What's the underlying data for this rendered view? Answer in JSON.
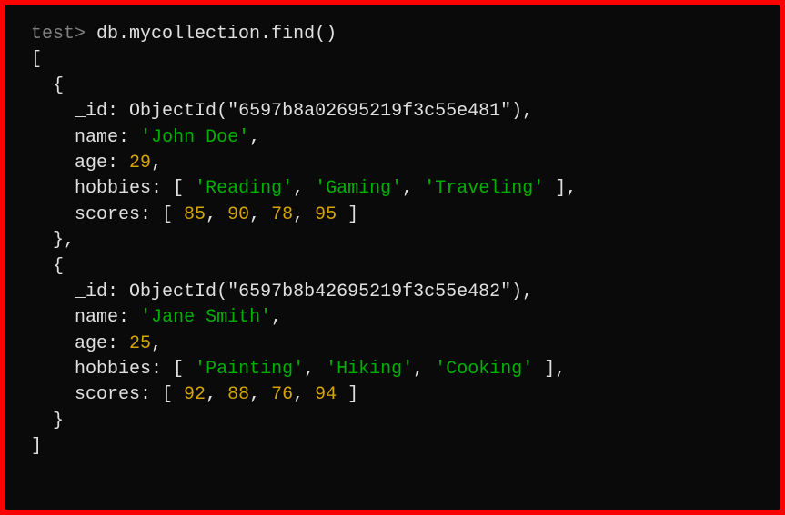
{
  "prompt": {
    "db": "test",
    "command": "db.mycollection.find()"
  },
  "results": [
    {
      "id_func": "ObjectId",
      "id": "6597b8a02695219f3c55e481",
      "name": "John Doe",
      "age": 29,
      "hobbies": [
        "Reading",
        "Gaming",
        "Traveling"
      ],
      "scores": [
        85,
        90,
        78,
        95
      ]
    },
    {
      "id_func": "ObjectId",
      "id": "6597b8b42695219f3c55e482",
      "name": "Jane Smith",
      "age": 25,
      "hobbies": [
        "Painting",
        "Hiking",
        "Cooking"
      ],
      "scores": [
        92,
        88,
        76,
        94
      ]
    }
  ],
  "labels": {
    "id_key": "_id",
    "name_key": "name",
    "age_key": "age",
    "hobbies_key": "hobbies",
    "scores_key": "scores"
  }
}
